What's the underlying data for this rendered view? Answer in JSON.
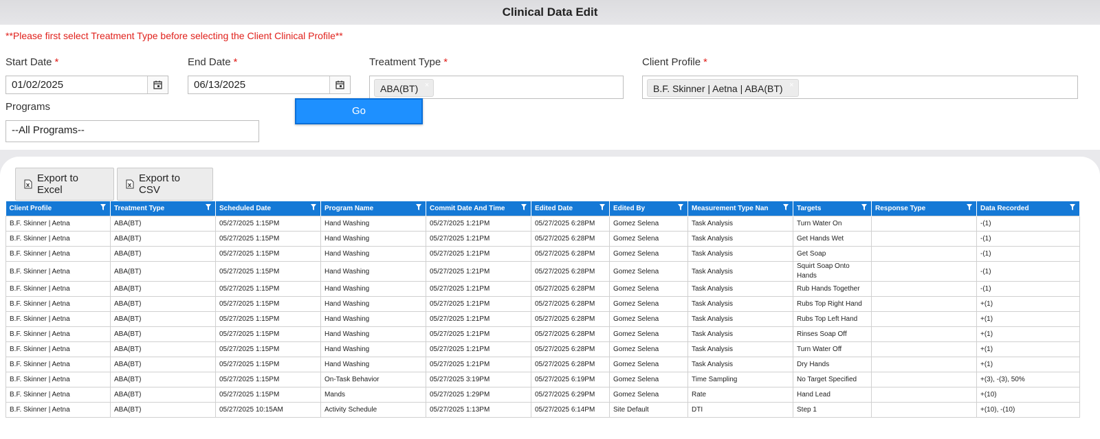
{
  "page": {
    "title": "Clinical Data Edit"
  },
  "filters": {
    "warning": "**Please first select Treatment Type before selecting the Client Clinical Profile**",
    "start_date": {
      "label": "Start Date",
      "value": "01/02/2025"
    },
    "end_date": {
      "label": "End Date",
      "value": "06/13/2025"
    },
    "treatment_type": {
      "label": "Treatment Type",
      "tag": "ABA(BT)"
    },
    "client_profile": {
      "label": "Client Profile",
      "tag": "B.F. Skinner | Aetna | ABA(BT)"
    },
    "programs": {
      "label": "Programs",
      "value": "--All Programs--"
    },
    "required_mark": "*",
    "remove_mark": "×",
    "go_label": "Go"
  },
  "toolbar": {
    "export_excel": "Export to Excel",
    "export_csv": "Export to CSV"
  },
  "colors": {
    "header_blue": "#1579d6",
    "go_blue": "#1e90ff",
    "warning_red": "#e0201b"
  },
  "table": {
    "columns": [
      "Client Profile",
      "Treatment Type",
      "Scheduled Date",
      "Program Name",
      "Commit Date And Time",
      "Edited Date",
      "Edited By",
      "Measurement Type Nan",
      "Targets",
      "Response Type",
      "Data Recorded"
    ],
    "rows": [
      [
        "B.F. Skinner | Aetna",
        "ABA(BT)",
        "05/27/2025 1:15PM",
        "Hand Washing",
        "05/27/2025 1:21PM",
        "05/27/2025 6:28PM",
        "Gomez Selena",
        "Task Analysis",
        "Turn Water On",
        "",
        "-(1)"
      ],
      [
        "B.F. Skinner | Aetna",
        "ABA(BT)",
        "05/27/2025 1:15PM",
        "Hand Washing",
        "05/27/2025 1:21PM",
        "05/27/2025 6:28PM",
        "Gomez Selena",
        "Task Analysis",
        "Get Hands Wet",
        "",
        "-(1)"
      ],
      [
        "B.F. Skinner | Aetna",
        "ABA(BT)",
        "05/27/2025 1:15PM",
        "Hand Washing",
        "05/27/2025 1:21PM",
        "05/27/2025 6:28PM",
        "Gomez Selena",
        "Task Analysis",
        "Get Soap",
        "",
        "-(1)"
      ],
      [
        "B.F. Skinner | Aetna",
        "ABA(BT)",
        "05/27/2025 1:15PM",
        "Hand Washing",
        "05/27/2025 1:21PM",
        "05/27/2025 6:28PM",
        "Gomez Selena",
        "Task Analysis",
        "Squirt Soap Onto Hands",
        "",
        "-(1)"
      ],
      [
        "B.F. Skinner | Aetna",
        "ABA(BT)",
        "05/27/2025 1:15PM",
        "Hand Washing",
        "05/27/2025 1:21PM",
        "05/27/2025 6:28PM",
        "Gomez Selena",
        "Task Analysis",
        "Rub Hands Together",
        "",
        "-(1)"
      ],
      [
        "B.F. Skinner | Aetna",
        "ABA(BT)",
        "05/27/2025 1:15PM",
        "Hand Washing",
        "05/27/2025 1:21PM",
        "05/27/2025 6:28PM",
        "Gomez Selena",
        "Task Analysis",
        "Rubs Top Right Hand",
        "",
        "+(1)"
      ],
      [
        "B.F. Skinner | Aetna",
        "ABA(BT)",
        "05/27/2025 1:15PM",
        "Hand Washing",
        "05/27/2025 1:21PM",
        "05/27/2025 6:28PM",
        "Gomez Selena",
        "Task Analysis",
        "Rubs Top Left Hand",
        "",
        "+(1)"
      ],
      [
        "B.F. Skinner | Aetna",
        "ABA(BT)",
        "05/27/2025 1:15PM",
        "Hand Washing",
        "05/27/2025 1:21PM",
        "05/27/2025 6:28PM",
        "Gomez Selena",
        "Task Analysis",
        "Rinses Soap Off",
        "",
        "+(1)"
      ],
      [
        "B.F. Skinner | Aetna",
        "ABA(BT)",
        "05/27/2025 1:15PM",
        "Hand Washing",
        "05/27/2025 1:21PM",
        "05/27/2025 6:28PM",
        "Gomez Selena",
        "Task Analysis",
        "Turn Water Off",
        "",
        "+(1)"
      ],
      [
        "B.F. Skinner | Aetna",
        "ABA(BT)",
        "05/27/2025 1:15PM",
        "Hand Washing",
        "05/27/2025 1:21PM",
        "05/27/2025 6:28PM",
        "Gomez Selena",
        "Task Analysis",
        "Dry Hands",
        "",
        "+(1)"
      ],
      [
        "B.F. Skinner | Aetna",
        "ABA(BT)",
        "05/27/2025 1:15PM",
        "On-Task Behavior",
        "05/27/2025 3:19PM",
        "05/27/2025 6:19PM",
        "Gomez Selena",
        "Time Sampling",
        "No Target Specified",
        "",
        "+(3), -(3), 50%"
      ],
      [
        "B.F. Skinner | Aetna",
        "ABA(BT)",
        "05/27/2025 1:15PM",
        "Mands",
        "05/27/2025 1:29PM",
        "05/27/2025 6:29PM",
        "Gomez Selena",
        "Rate",
        "Hand Lead",
        "",
        "+(10)"
      ],
      [
        "B.F. Skinner | Aetna",
        "ABA(BT)",
        "05/27/2025 10:15AM",
        "Activity Schedule",
        "05/27/2025 1:13PM",
        "05/27/2025 6:14PM",
        "Site Default",
        "DTI",
        "Step 1",
        "",
        "+(10), -(10)"
      ]
    ]
  }
}
